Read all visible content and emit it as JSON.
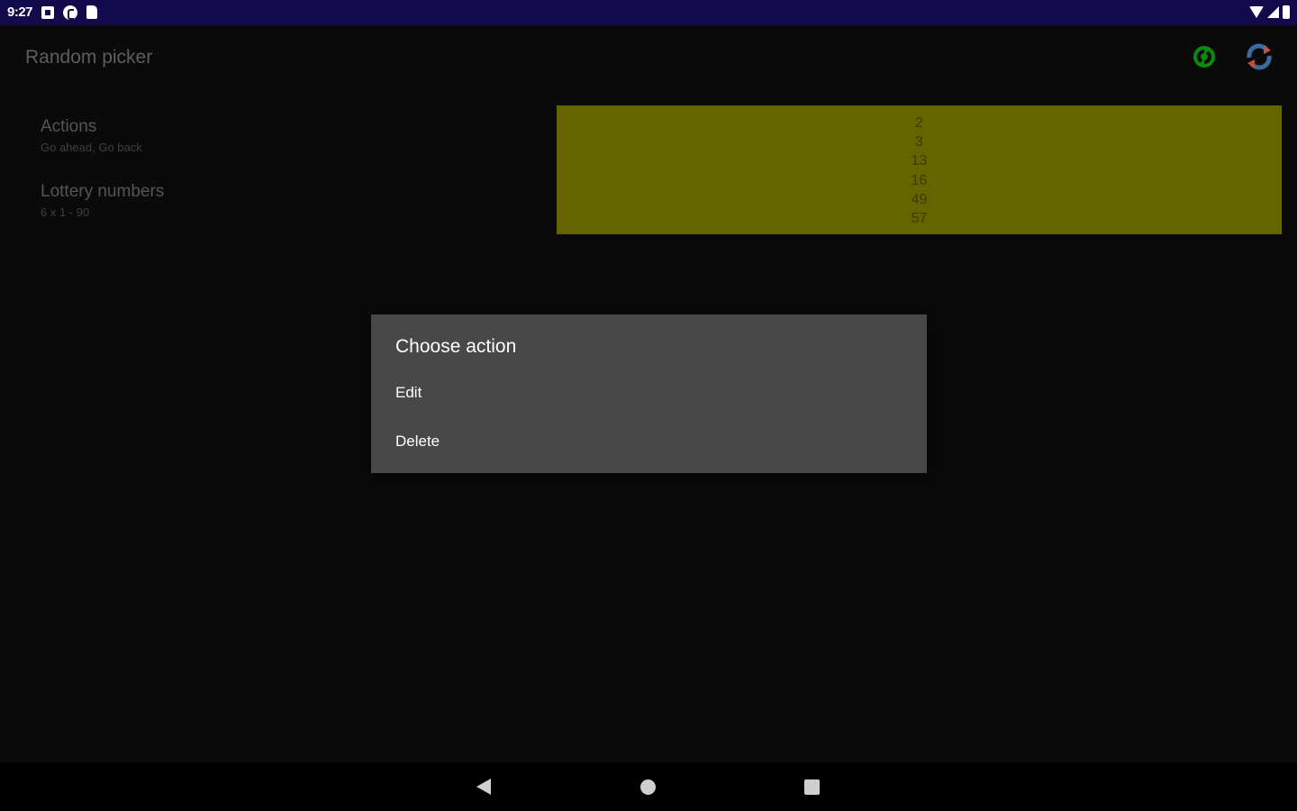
{
  "status_bar": {
    "time": "9:27",
    "left_icons": [
      "notification-square-icon",
      "app-notification-icon",
      "sd-card-icon"
    ],
    "right_icons": [
      "wifi-icon",
      "signal-icon",
      "battery-icon"
    ],
    "background_color": "#120a4a"
  },
  "app_bar": {
    "title": "Random picker",
    "actions": [
      {
        "icon": "sync-icon",
        "color": "#0a8a0a"
      },
      {
        "icon": "refresh-icon",
        "color": "#3a6aa0"
      }
    ]
  },
  "list": {
    "items": [
      {
        "title": "Actions",
        "subtitle": "Go ahead, Go back"
      },
      {
        "title": "Lottery numbers",
        "subtitle": "6 x 1 - 90"
      }
    ]
  },
  "result": {
    "numbers": [
      "2",
      "3",
      "13",
      "16",
      "49",
      "57"
    ],
    "background_color": "#646400"
  },
  "dialog": {
    "title": "Choose action",
    "items": [
      {
        "label": "Edit"
      },
      {
        "label": "Delete"
      }
    ],
    "background_color": "#484848"
  },
  "nav_bar": {
    "buttons": [
      "back-icon",
      "home-icon",
      "recents-icon"
    ]
  }
}
